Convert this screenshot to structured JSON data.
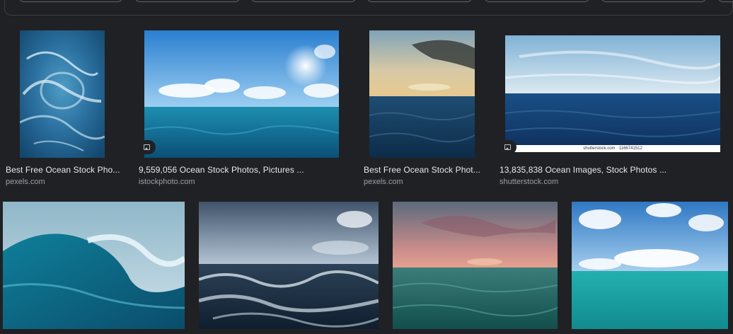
{
  "results": [
    {
      "title": "Best Free Ocean Stock Pho...",
      "source": "pexels.com"
    },
    {
      "title": "9,559,056 Ocean Stock Photos, Pictures ...",
      "source": "istockphoto.com"
    },
    {
      "title": "Best Free Ocean Stock Phot...",
      "source": "pexels.com"
    },
    {
      "title": "13,835,838 Ocean Images, Stock Photos ...",
      "source": "shutterstock.com",
      "watermark": "shutterstock.com · 1166741512"
    }
  ],
  "icons": {
    "image_badge": "image-icon"
  }
}
